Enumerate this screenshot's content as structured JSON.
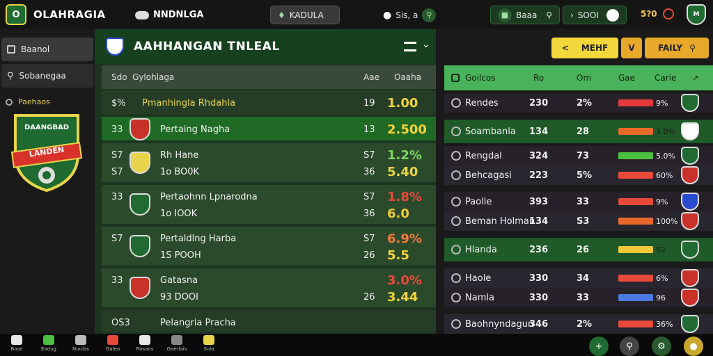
{
  "header": {
    "logo_text": "O",
    "app_title": "OLAHRAGIA",
    "toggle_label": "NNDNLGA",
    "center_button": "KADULA",
    "search_label": "Sis, a",
    "balance_label": "Baaa",
    "account_label": "SOOI",
    "count_value": "5?0",
    "crest_text": "M"
  },
  "sidebar": {
    "items": [
      {
        "label": "Baanol",
        "icon": "grid-icon"
      },
      {
        "label": "Sobanegaa",
        "icon": "search-icon"
      }
    ],
    "section_label": "Paehaos",
    "crest_text_top": "DAANGBAD",
    "crest_text_banner": "LANDEN"
  },
  "center": {
    "league_title": "AAHHANGAN TNLEAL",
    "columns": {
      "code": "Sdo",
      "name": "Gylohlaga",
      "num": "Aae",
      "odds": "Oaaha"
    },
    "matches": [
      {
        "code": "$%",
        "name": "Pmanhingla Rhdahla",
        "num": "19",
        "odds": "1.00",
        "odds_color": "#f2d23a",
        "style": "dark"
      },
      {
        "code": "33",
        "name": "Pertaing Nagha",
        "num": "13",
        "odds": "2.500",
        "odds_color": "#f2d23a",
        "style": "hl"
      },
      {
        "code": "S7",
        "name": "Rh Hane",
        "num": "S7",
        "odds": "1.2%",
        "odds_color": "#7bd860",
        "code2": "S7",
        "name2": "1o  BO0K",
        "num2": "36",
        "odds2": "5.40",
        "odds2_color": "#e8d44a",
        "style": "norm"
      },
      {
        "code": "33",
        "name": "Pertaohnn Lpnarodna",
        "num": "S7",
        "odds": "1.8%",
        "odds_color": "#e84a3a",
        "code2": "",
        "name2": "1o  IOOK",
        "num2": "36",
        "odds2": "6.0",
        "odds2_color": "#f2c83a",
        "style": "norm"
      },
      {
        "code": "S7",
        "name": "Pertaldlng Harba",
        "num": "S7",
        "odds": "6.9%",
        "odds_color": "#f07a3a",
        "code2": "",
        "name2": "1S  POOH",
        "num2": "26",
        "odds2": "5.5",
        "odds2_color": "#f2d23a",
        "style": "norm"
      },
      {
        "code": "33",
        "name": "Gatasna",
        "num": "",
        "odds": "3.0%",
        "odds_color": "#e84a3a",
        "code2": "",
        "name2": "93  DOOI",
        "num2": "26",
        "odds2": "3.44",
        "odds2_color": "#f2d23a",
        "style": "norm"
      },
      {
        "code": "OS3",
        "name": "Pelangria Pracha",
        "num": "",
        "odds": "",
        "odds_color": "#f2d23a",
        "style": "dark"
      }
    ]
  },
  "right": {
    "buttons": {
      "back": "<",
      "menu": "MEHF",
      "expand": "V",
      "filter": "FAILY"
    },
    "columns": {
      "name": "Goilcos",
      "a": "Ro",
      "b": "Om",
      "c": "Gae",
      "d": "Carie"
    },
    "rows": [
      {
        "name": "Rendes",
        "a": "230",
        "b": "2%",
        "pct": "9%",
        "bar_color": "#e23a3a"
      },
      {
        "name": "Soambanla",
        "a": "134",
        "b": "28",
        "pct": "3.0%",
        "bar_color": "#e86a2a",
        "hl": true
      },
      {
        "name": "Rengdal",
        "a": "324",
        "b": "73",
        "pct": "5.0%",
        "bar_color": "#4cc040"
      },
      {
        "name": "Behcagasi",
        "a": "223",
        "b": "5%",
        "pct": "60%",
        "bar_color": "#e84a3a"
      },
      {
        "name": "Paolle",
        "a": "393",
        "b": "33",
        "pct": "9%",
        "bar_color": "#e84a3a"
      },
      {
        "name": "Beman Holman",
        "a": "134",
        "b": "S3",
        "pct": "100%",
        "bar_color": "#e86a2a"
      },
      {
        "name": "Hlanda",
        "a": "236",
        "b": "26",
        "pct": "S2",
        "bar_color": "#f2c83a",
        "hl": true
      },
      {
        "name": "Haole",
        "a": "330",
        "b": "34",
        "pct": "6%",
        "bar_color": "#e84a3a"
      },
      {
        "name": "Namla",
        "a": "330",
        "b": "33",
        "pct": "96",
        "bar_color": "#4a7ae0"
      },
      {
        "name": "Baohnyndagun",
        "a": "346",
        "b": "2%",
        "pct": "36%",
        "bar_color": "#e84a3a"
      }
    ]
  },
  "bottom_nav": {
    "items": [
      "Base",
      "Eadug",
      "Nuulas",
      "Galeo",
      "Rosaos",
      "Gaerlais",
      "Sola"
    ],
    "colors": [
      "#e8e8e8",
      "#4cc040",
      "#bbbbbb",
      "#e84a3a",
      "#e8e8e8",
      "#888888",
      "#e8d44a"
    ]
  }
}
